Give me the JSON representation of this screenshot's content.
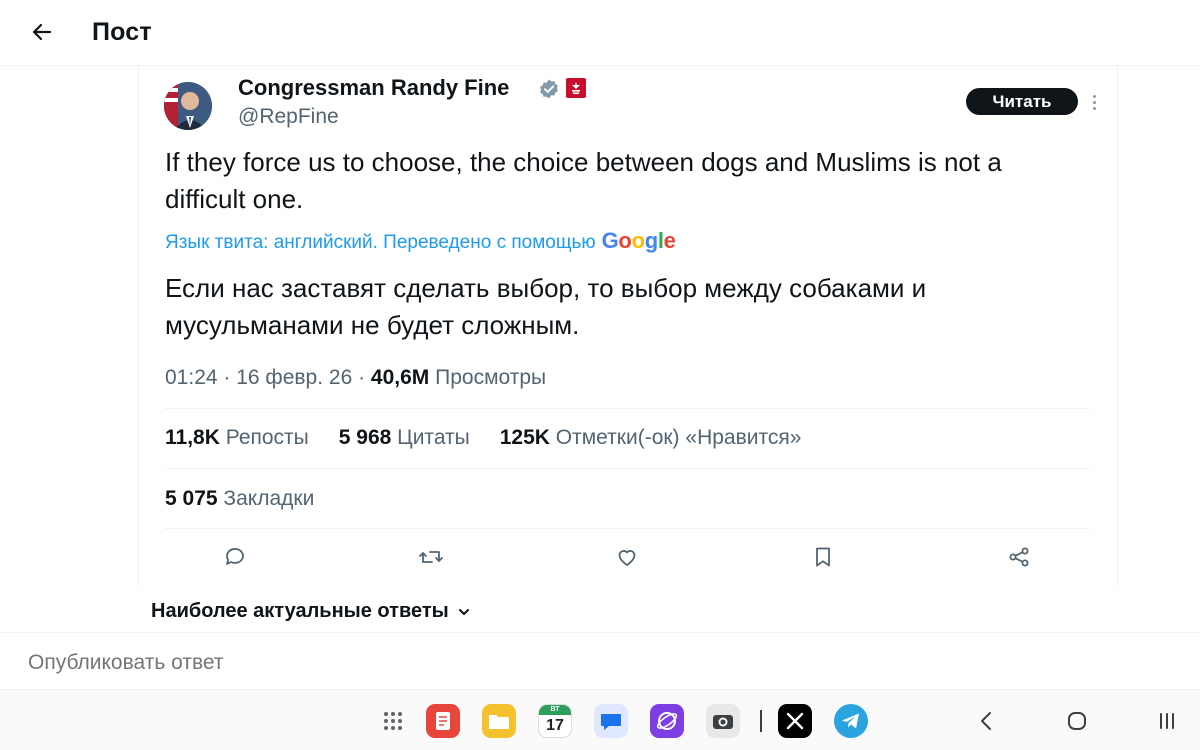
{
  "header": {
    "title": "Пост",
    "back_icon": "arrow-left-icon"
  },
  "author": {
    "name": "Congressman Randy Fine",
    "handle": "@RepFine",
    "verified_icon": "verified-badge-icon",
    "affiliation_icon": "government-affiliation-badge-icon",
    "follow_label": "Читать",
    "more_icon": "more-vertical-icon"
  },
  "tweet": {
    "text": "If they force us to choose, the choice between dogs and Muslims is not a difficult one.",
    "translation_note": "Язык твита: английский. Переведено с помощью",
    "translation_provider": "Google",
    "translated_text": "Если нас заставят сделать выбор, то выбор между собаками и мусульманами не будет сложным.",
    "time": "01:24",
    "date": "16 февр. 26",
    "views_count": "40,6M",
    "views_label": "Просмотры"
  },
  "stats": {
    "reposts": {
      "count": "11,8K",
      "label": "Репосты"
    },
    "quotes": {
      "count": "5 968",
      "label": "Цитаты"
    },
    "likes": {
      "count": "125K",
      "label": "Отметки(-ок) «Нравится»"
    },
    "bookmarks": {
      "count": "5 075",
      "label": "Закладки"
    }
  },
  "actions": [
    "reply-icon",
    "repost-icon",
    "like-icon",
    "bookmark-icon",
    "share-icon"
  ],
  "replies": {
    "sort_label": "Наиболее актуальные ответы"
  },
  "compose": {
    "placeholder": "Опубликовать ответ"
  },
  "taskbar": {
    "calendar_day": "17",
    "calendar_weekday": "ВТ",
    "apps": [
      "app-drawer-icon",
      "notes-app-icon",
      "files-app-icon",
      "calendar-app-icon",
      "messages-app-icon",
      "browser-app-icon",
      "camera-app-icon",
      "x-app-icon",
      "telegram-app-icon"
    ],
    "nav": [
      "back-nav-icon",
      "home-nav-icon",
      "recents-nav-icon"
    ]
  },
  "colors": {
    "accent": "#1d9bf0",
    "text": "#0f1419",
    "secondary": "#536471",
    "badge_red": "#c8102e"
  }
}
